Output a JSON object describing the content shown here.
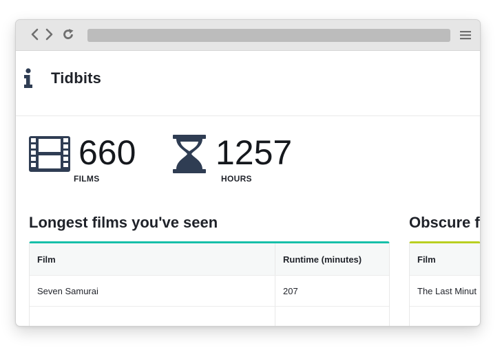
{
  "app": {
    "title": "Tidbits",
    "icons": {
      "header": "info-icon",
      "films": "film-strip-icon",
      "hours": "hourglass-icon"
    }
  },
  "browser": {
    "icons": [
      "back-icon",
      "forward-icon",
      "reload-icon",
      "menu-icon"
    ]
  },
  "stats": {
    "films": {
      "value": "660",
      "label": "FILMS"
    },
    "hours": {
      "value": "1257",
      "label": "HOURS"
    }
  },
  "longest": {
    "title": "Longest films you've seen",
    "columns": [
      "Film",
      "Runtime (minutes)"
    ],
    "rows": [
      [
        "Seven Samurai",
        "207"
      ]
    ]
  },
  "obscure": {
    "title": "Obscure f",
    "columns": [
      "Film"
    ],
    "rows": [
      [
        "The Last Minut"
      ]
    ]
  },
  "colors": {
    "accent_teal": "#16bfa9",
    "accent_lime": "#b9cf20",
    "icon_navy": "#2f3d53"
  }
}
